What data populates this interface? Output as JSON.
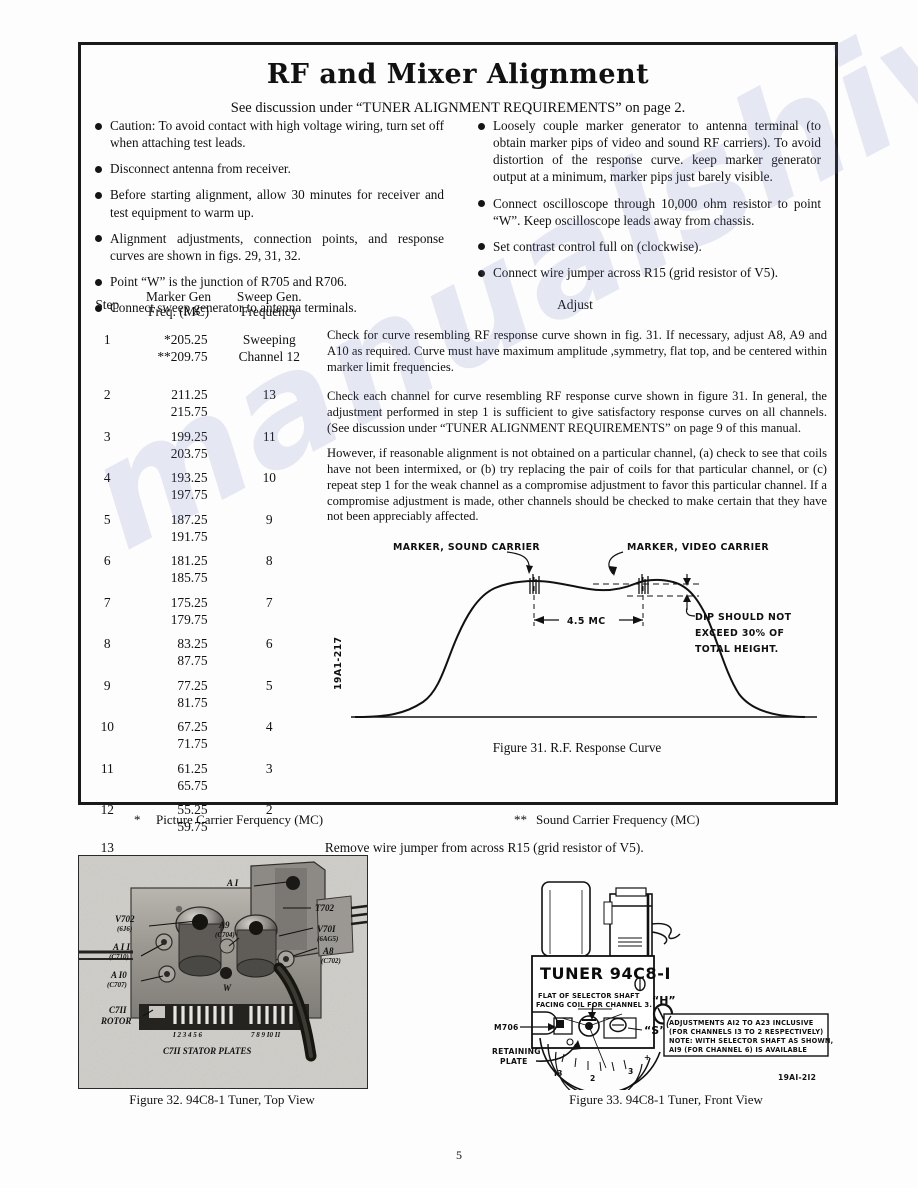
{
  "header": {
    "title": "RF and Mixer Alignment",
    "subtitle": "See discussion under “TUNER ALIGNMENT REQUIREMENTS” on page 2."
  },
  "bullets_left": [
    "Caution: To avoid contact with high voltage wiring, turn set off when attaching test leads.",
    "Disconnect antenna from receiver.",
    "Before starting alignment, allow 30 minutes for receiver and test equipment to warm up.",
    "Alignment adjustments, connection points, and response curves are shown in figs. 29, 31, 32.",
    "Point “W” is the junction of R705 and R706.",
    "Connect sweep generator to antenna terminals."
  ],
  "bullets_right": [
    "Loosely couple marker generator to antenna terminal (to obtain marker pips of video and sound RF carriers). To avoid distortion of the response curve. keep marker generator output at a minimum, marker pips just barely visible.",
    "Connect oscilloscope through 10,000 ohm resistor to point “W”. Keep oscilloscope leads away from chassis.",
    "Set contrast control full on (clockwise).",
    "Connect wire jumper across R15 (grid resistor of V5)."
  ],
  "table": {
    "headers": {
      "step": "Step",
      "marker": "Marker Gen\nFreq.  (MC)",
      "sweep": "Sweep Gen.\nFrequency",
      "adjust": "Adjust"
    },
    "rows": [
      {
        "step": "1",
        "marker": "*205.25\n**209.75",
        "sweep": "Sweeping\nChannel  12"
      },
      {
        "step": "2",
        "marker": "211.25\n215.75",
        "sweep": "13"
      },
      {
        "step": "3",
        "marker": "199.25\n203.75",
        "sweep": "11"
      },
      {
        "step": "4",
        "marker": "193.25\n197.75",
        "sweep": "10"
      },
      {
        "step": "5",
        "marker": "187.25\n191.75",
        "sweep": "9"
      },
      {
        "step": "6",
        "marker": "181.25\n185.75",
        "sweep": "8"
      },
      {
        "step": "7",
        "marker": "175.25\n179.75",
        "sweep": "7"
      },
      {
        "step": "8",
        "marker": "83.25\n87.75",
        "sweep": "6"
      },
      {
        "step": "9",
        "marker": "77.25\n81.75",
        "sweep": "5"
      },
      {
        "step": "10",
        "marker": "67.25\n71.75",
        "sweep": "4"
      },
      {
        "step": "11",
        "marker": "61.25\n65.75",
        "sweep": "3"
      },
      {
        "step": "12",
        "marker": "55.25\n59.75",
        "sweep": "2"
      }
    ],
    "adjust_step1": "Check for curve resembling RF response curve shown in fig. 31. If necessary, adjust A8, A9 and A10 as required. Curve must have maximum amplitude ,symmetry, flat top, and be centered within marker limit frequencies.",
    "adjust_rest_p1": "Check each channel for curve resembling RF response curve shown in figure 31. In general, the adjustment performed in step 1 is sufficient to give satisfactory response curves on all channels. (See discussion under “TUNER ALIGNMENT REQUIREMENTS” on page 9 of this manual.",
    "adjust_rest_p2": "However, if reasonable alignment is not obtained on a particular channel, (a) check to see that coils have not been intermixed, or (b) try replacing the pair of coils for that particular channel, or (c) repeat step 1 for the weak channel as a compromise adjustment to favor this particular channel. If a compromise adjustment is made, other channels should be checked to make certain that they have not been appreciably affected.",
    "last_row_step": "13",
    "last_row_text": "Remove wire jumper from across R15 (grid resistor of V5)."
  },
  "figure31": {
    "caption": "Figure 31. R.F. Response Curve",
    "id_tag": "19A1-217",
    "label_sound": "MARKER, SOUND CARRIER",
    "label_video": "MARKER, VIDEO CARRIER",
    "label_span": "4.5 MC",
    "note_line1": "DIP SHOULD NOT",
    "note_line2": "EXCEED 30% OF",
    "note_line3": "TOTAL HEIGHT."
  },
  "footnotes": {
    "left_mark": "*",
    "left_text": "Picture Carrier Ferquency  (MC)",
    "right_mark": "**",
    "right_text": "Sound Carrier Frequency  (MC)"
  },
  "figure32": {
    "caption": "Figure 32. 94C8-1 Tuner, Top View",
    "labels": {
      "a1": "A I",
      "v702": "V702",
      "v702sub": "(6J6)",
      "a9": "A9",
      "a9sub": "(C704)",
      "a11": "A I I",
      "a11sub": "(C710)",
      "a10": "A I0",
      "a10sub": "(C707)",
      "t702": "T702",
      "v701": "V70I",
      "v701sub": "(6AG5)",
      "a8": "A8",
      "a8sub": "(C702)",
      "c711rotor_l1": "C7II",
      "c711rotor_l2": "ROTOR",
      "stator": "C7II STATOR PLATES",
      "w": "W",
      "plate_numbers_left": "I  2  3  4  5  6",
      "plate_numbers_right": "7  8  9 I0 II"
    }
  },
  "figure33": {
    "caption": "Figure 33. 94C8-1 Tuner, Front View",
    "id_tag": "19AI-2I2",
    "tuner_label": "TUNER 94C8-I",
    "flat_line1": "FLAT OF SELECTOR   SHAFT",
    "flat_line2": "FACING COIL  FOR CHANNEL 3.",
    "h_label": "“H”",
    "s_label": "“S”",
    "m706": "M706",
    "retaining_l1": "RETAINING",
    "retaining_l2": "PLATE",
    "note_l1": "ADJUSTMENTS   AI2   TO   A23   INCLUSIVE",
    "note_l2": "(FOR CHANNELS  I3  TO  2  RESPECTIVELY)",
    "note_l3": "NOTE: WITH  SELECTOR   SHAFT  AS SHOWN,",
    "note_l4": "AI9 (FOR  CHANNEL  6)  IS  AVAILABLE",
    "dial_num2": "2",
    "dial_num3": "3",
    "dial_num13": "I3"
  },
  "page_number": "5",
  "watermark": "manualshive",
  "colors": {
    "ink": "#111111",
    "rule": "#222222",
    "watermark": "#6c74be",
    "photo_bg": "#d8d6d2"
  }
}
